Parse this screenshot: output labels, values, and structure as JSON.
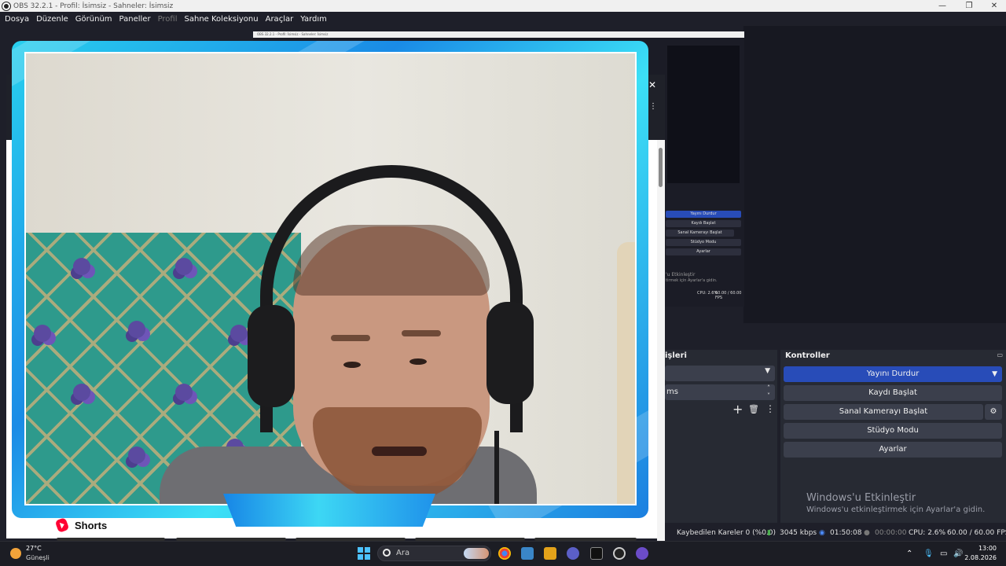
{
  "window": {
    "title": "OBS 32.2.1 - Profil: İsimsiz - Sahneler: İsimsiz",
    "controls": [
      "—",
      "❐",
      "✕"
    ]
  },
  "menu": [
    "Dosya",
    "Düzenle",
    "Görünüm",
    "Paneller",
    "Profil",
    "Sahne Koleksiyonu",
    "Araçlar",
    "Yardım"
  ],
  "mini_obs": {
    "title": "OBS 32.2.1 - Profil: İsimsiz - Sahneler: İsimsiz",
    "buttons": [
      "Yayını Durdur",
      "Kaydı Başlat",
      "Sanal Kamerayı Başlat",
      "Stüdyo Modu",
      "Ayarlar"
    ],
    "watermark1": "'u Etkinleştir",
    "watermark2": "tirmek için Ayarlar'a gidin.",
    "status_cpu": "CPU: 2.6%",
    "status_fps": "60.00 / 60.00 FPS"
  },
  "docks": {
    "audio_header_partial": "işleri",
    "audio_value_partial": "ms",
    "controls_header": "Kontroller",
    "controls_buttons": {
      "stream": "Yayını Durdur",
      "record": "Kaydı Başlat",
      "virtual_cam": "Sanal Kamerayı Başlat",
      "studio": "Stüdyo Modu",
      "settings": "Ayarlar"
    }
  },
  "activation": {
    "line1": "Windows'u Etkinleştir",
    "line2": "Windows'u etkinleştirmek için Ayarlar'a gidin."
  },
  "status": {
    "dropped": "Kaybedilen Kareler 0 (%0.0)",
    "bitrate": "3045 kbps",
    "stream_time": "01:50:08",
    "rec_time": "00:00:00",
    "cpu": "CPU: 2.6%",
    "fps": "60.00 / 60.00 FPS"
  },
  "overlay": {
    "shorts_label": "Shorts"
  },
  "taskbar": {
    "temperature": "27°C",
    "condition": "Güneşli",
    "search_placeholder": "Ara",
    "time": "13:00",
    "date": "2.08.2026"
  },
  "colors": {
    "accent_blue": "#284cb8",
    "frame_cyan": "#29d0ee",
    "dock_bg": "#272a33"
  }
}
